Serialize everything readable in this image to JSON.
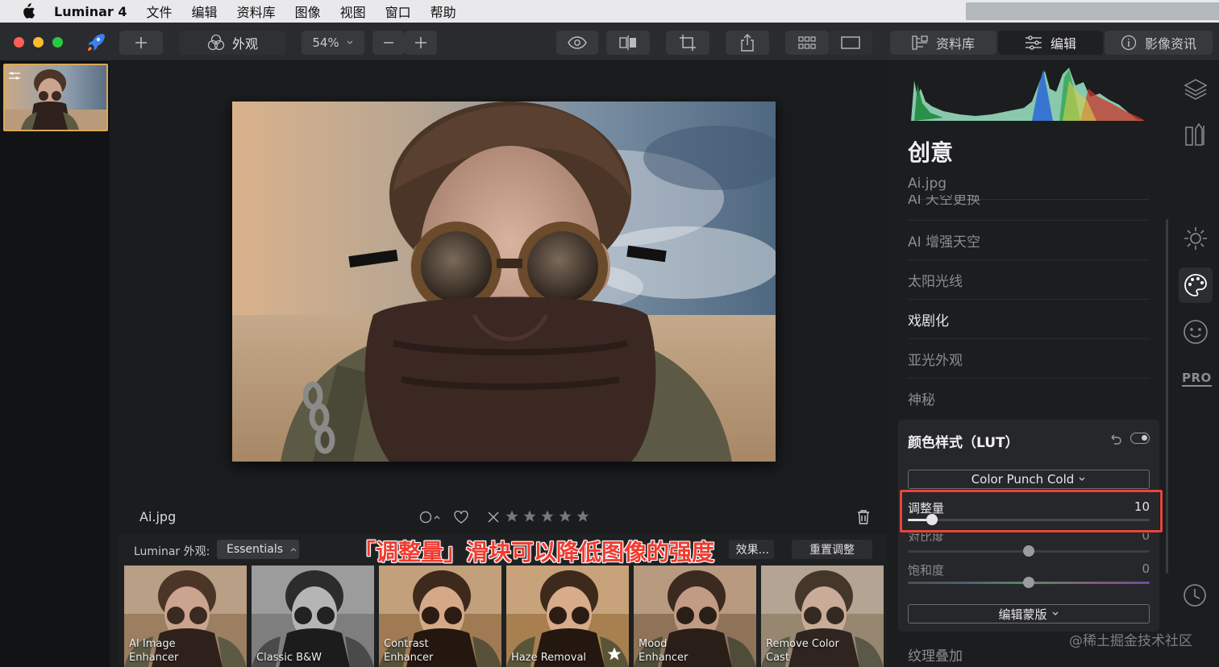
{
  "menubar": {
    "app_name": "Luminar 4",
    "items": [
      "文件",
      "编辑",
      "资料库",
      "图像",
      "视图",
      "窗口",
      "帮助"
    ]
  },
  "toolbar": {
    "looks_label": "外观",
    "zoom_value": "54%",
    "library_tab": "资料库",
    "edit_tab": "编辑",
    "info_tab": "影像资讯"
  },
  "canvas": {
    "file_name": "Ai.jpg"
  },
  "looks_bar": {
    "label": "Luminar 外观:",
    "collection": "Essentials",
    "effects_button": "效果...",
    "reset_button": "重置调整",
    "tiles": [
      {
        "label": "AI Image\nEnhancer"
      },
      {
        "label": "Classic B&W"
      },
      {
        "label": "Contrast\nEnhancer"
      },
      {
        "label": "Haze Removal"
      },
      {
        "label": "Mood\nEnhancer"
      },
      {
        "label": "Remove Color\nCast"
      }
    ]
  },
  "annotation": "「调整量」滑块可以降低图像的强度",
  "panel": {
    "section_title": "创意",
    "file_name": "Ai.jpg",
    "partial_tool": "AI 天空更换",
    "tools": [
      "AI 增强天空",
      "太阳光线",
      "戏剧化",
      "亚光外观",
      "神秘"
    ],
    "lut": {
      "title": "颜色样式（LUT）",
      "preset": "Color Punch Cold",
      "amount_label": "调整量",
      "amount_value": "10",
      "amount_level": 0.1,
      "contrast_label": "对比度",
      "contrast_value": "0",
      "saturation_label": "饱和度",
      "saturation_value": "0",
      "mask_button": "编辑蒙版"
    },
    "next_tool": "纹理叠加"
  },
  "sidebar": {
    "pro_label": "PRO"
  },
  "watermark": "@稀土掘金技术社区"
}
